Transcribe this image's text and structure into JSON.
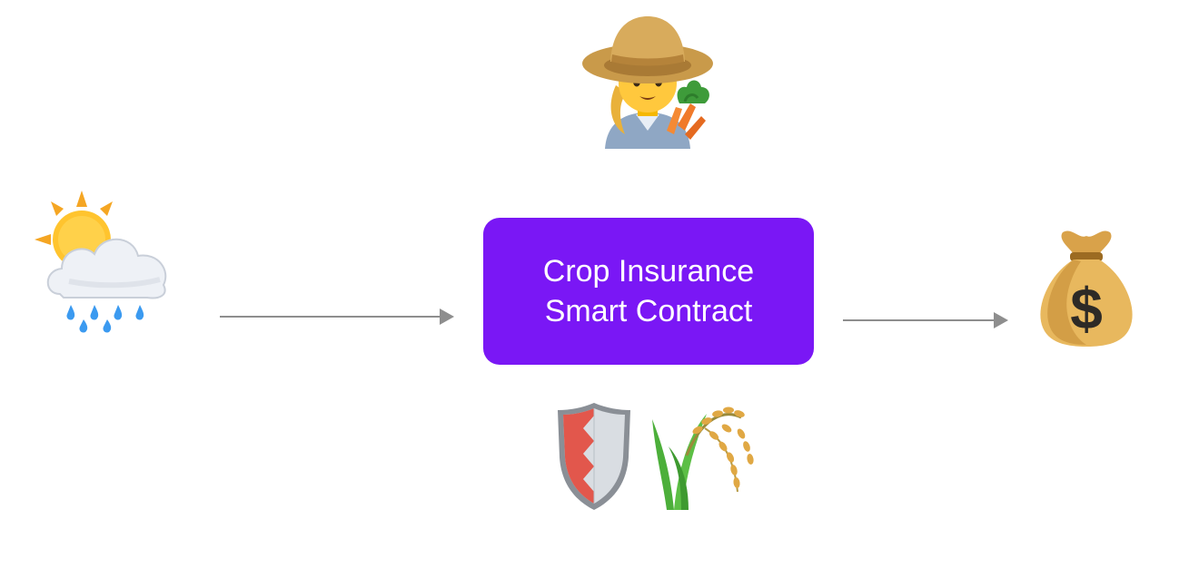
{
  "contract": {
    "line1": "Crop Insurance",
    "line2": "Smart Contract"
  },
  "colors": {
    "box": "#7a17f5",
    "arrow": "#8e8e8e"
  },
  "icons": {
    "farmer": "farmer-icon",
    "weather": "sun-behind-rain-cloud-icon",
    "payout": "money-bag-icon",
    "shield": "shield-icon",
    "crop": "rice-sheaf-icon"
  }
}
